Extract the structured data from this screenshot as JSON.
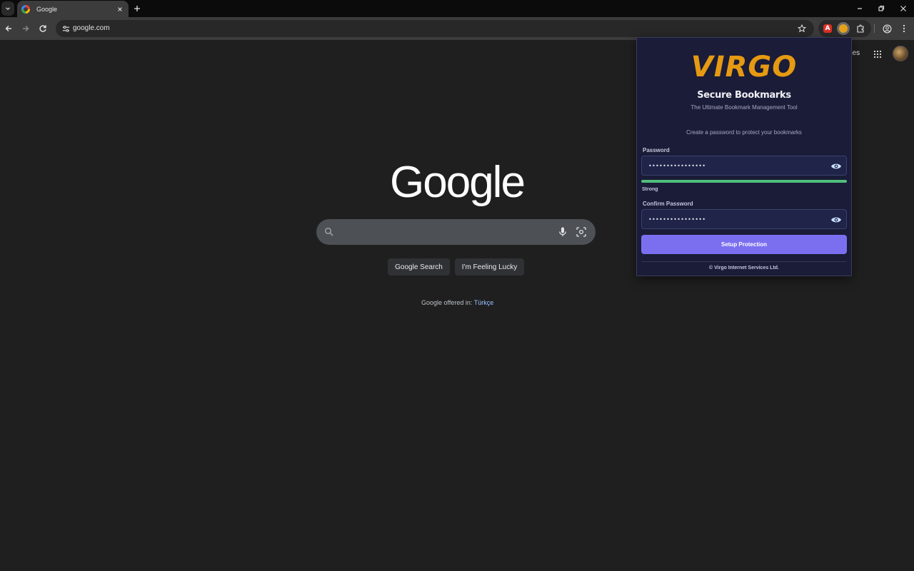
{
  "browser": {
    "tab": {
      "title": "Google",
      "favicon": "google-g-icon"
    },
    "url": "google.com",
    "icons": [
      "tab-search-icon",
      "close-icon",
      "plus-icon",
      "minimize-icon",
      "restore-icon",
      "window-close-icon",
      "back-icon",
      "forward-icon",
      "reload-icon",
      "site-settings-icon",
      "star-icon",
      "puzzle-icon",
      "profile-icon",
      "kebab-menu-icon"
    ],
    "extensions": [
      {
        "name": "acrobat-extension",
        "letter": "A",
        "color": "#d93025"
      },
      {
        "name": "virgo-extension",
        "color": "#e6a21a"
      }
    ]
  },
  "google": {
    "header_link": "ges",
    "logo": "Google",
    "search_placeholder": "",
    "buttons": {
      "search": "Google Search",
      "lucky": "I'm Feeling Lucky"
    },
    "offered_prefix": "Google offered in: ",
    "offered_language": "Türkçe"
  },
  "popup": {
    "logo_text": "VIRGO",
    "logo_color": "#e59a12",
    "title": "Secure Bookmarks",
    "subtitle": "The Ultimate Bookmark Management Tool",
    "prompt": "Create a password to protect your bookmarks",
    "password_label": "Password",
    "password_value": "••••••••••••••••",
    "strength_fraction": 1.0,
    "strength_text": "Strong",
    "strength_color": "#4fbf7a",
    "confirm_label": "Confirm Password",
    "confirm_value": "••••••••••••••••",
    "button_label": "Setup Protection",
    "button_color": "#7b6ff0",
    "footer": "©  Virgo Internet Services Ltd."
  }
}
